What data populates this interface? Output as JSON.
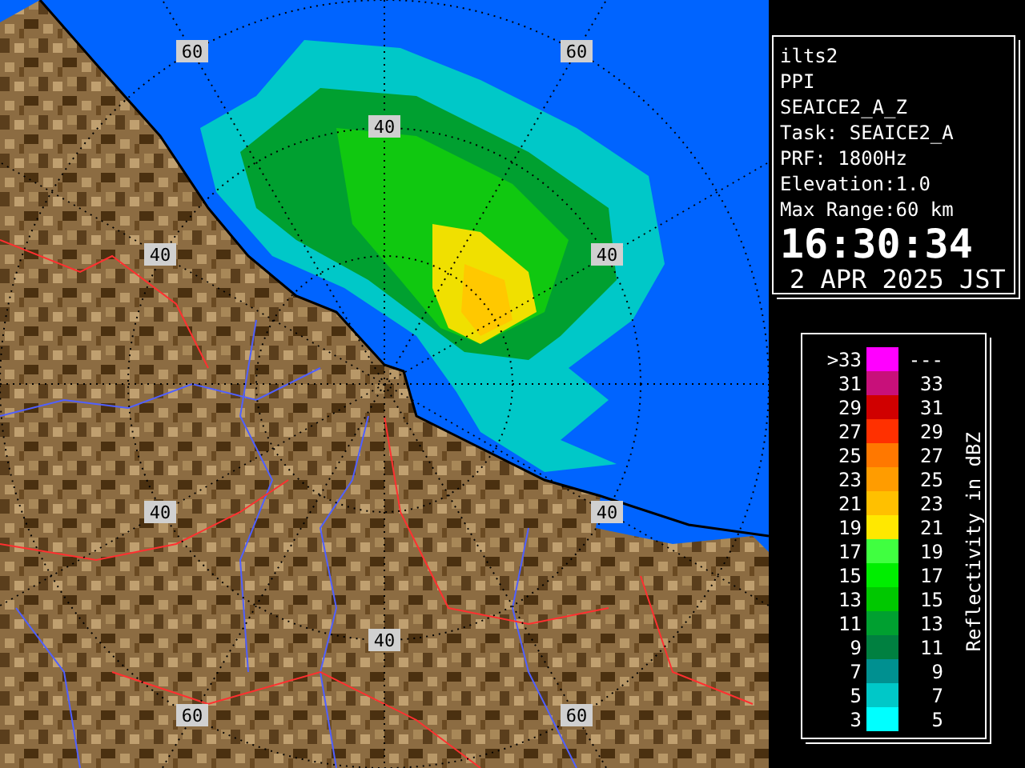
{
  "map": {
    "range_labels": [
      {
        "text": "60"
      },
      {
        "text": "60"
      },
      {
        "text": "40"
      },
      {
        "text": "40"
      },
      {
        "text": "40"
      },
      {
        "text": "40"
      },
      {
        "text": "40"
      },
      {
        "text": "40"
      },
      {
        "text": "60"
      },
      {
        "text": "60"
      }
    ]
  },
  "info": {
    "station": "ilts2",
    "scan_mode": "PPI",
    "product": "SEAICE2_A_Z",
    "task": "Task: SEAICE2_A",
    "prf": "PRF: 1800Hz",
    "elevation": "Elevation:1.0",
    "max_range": "Max Range:60 km",
    "time": "16:30:34",
    "date": "2 APR 2025 JST"
  },
  "legend": {
    "title": "Reflectivity in dBZ",
    "items": [
      {
        "low": ">33",
        "high": "---",
        "color": "#ff00ff"
      },
      {
        "low": "31",
        "high": "33",
        "color": "#c8107a"
      },
      {
        "low": "29",
        "high": "31",
        "color": "#d00000"
      },
      {
        "low": "27",
        "high": "29",
        "color": "#ff3000"
      },
      {
        "low": "25",
        "high": "27",
        "color": "#ff7800"
      },
      {
        "low": "23",
        "high": "25",
        "color": "#ff9c00"
      },
      {
        "low": "21",
        "high": "23",
        "color": "#ffc000"
      },
      {
        "low": "19",
        "high": "21",
        "color": "#ffe800"
      },
      {
        "low": "17",
        "high": "19",
        "color": "#40ff40"
      },
      {
        "low": "15",
        "high": "17",
        "color": "#00ee00"
      },
      {
        "low": "13",
        "high": "15",
        "color": "#00c800"
      },
      {
        "low": "11",
        "high": "13",
        "color": "#00a030"
      },
      {
        "low": "9",
        "high": "11",
        "color": "#008040"
      },
      {
        "low": "7",
        "high": "9",
        "color": "#009090"
      },
      {
        "low": "5",
        "high": "7",
        "color": "#00c8c8"
      },
      {
        "low": "3",
        "high": "5",
        "color": "#00ffff"
      }
    ]
  }
}
